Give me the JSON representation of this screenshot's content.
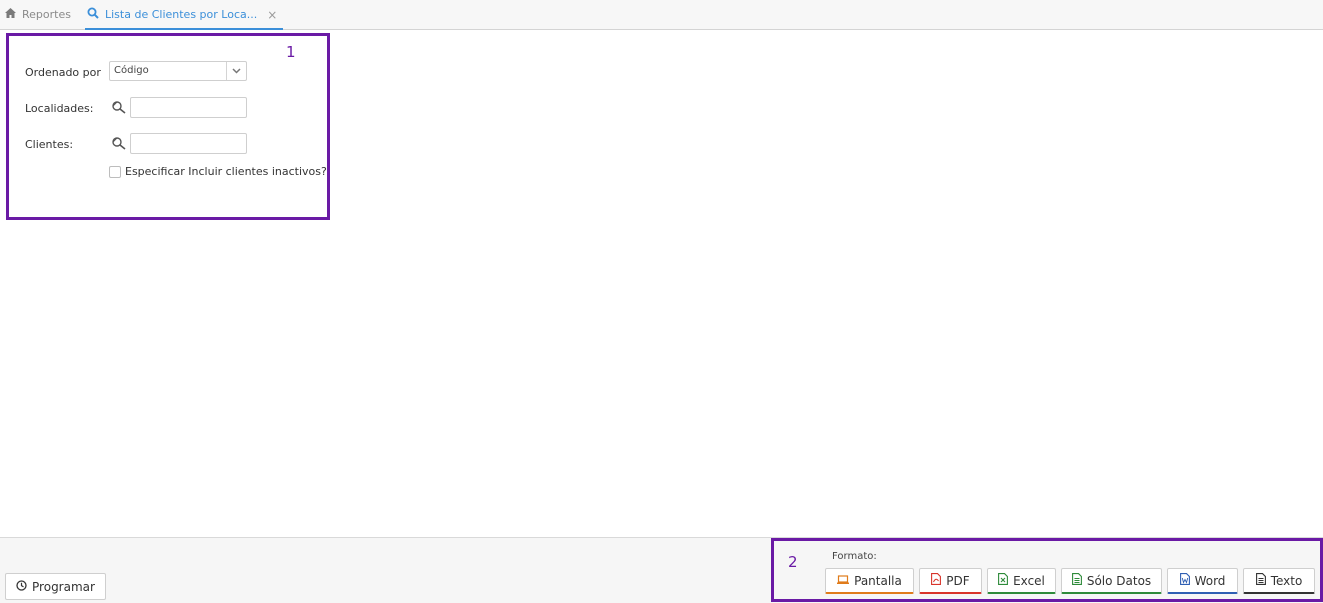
{
  "tabs": [
    {
      "label": "Reportes",
      "icon": "home-icon"
    },
    {
      "label": "Lista de Clientes por Loca...",
      "icon": "search-icon",
      "active": true
    }
  ],
  "annotations": {
    "box1": "1",
    "box2": "2"
  },
  "form": {
    "order_label": "Ordenado por",
    "order_value": "Código",
    "localidades_label": "Localidades:",
    "localidades_value": "",
    "clientes_label": "Clientes:",
    "clientes_value": "",
    "checkbox_label": "Especificar Incluir clientes inactivos?"
  },
  "footer": {
    "programar_label": "Programar",
    "formato_label": "Formato:",
    "formats": [
      {
        "label": "Pantalla",
        "accent": "#e07b1a",
        "icon": "monitor-icon"
      },
      {
        "label": "PDF",
        "accent": "#d9342b",
        "icon": "pdf-icon"
      },
      {
        "label": "Excel",
        "accent": "#2e8b3a",
        "icon": "excel-icon"
      },
      {
        "label": "Sólo Datos",
        "accent": "#2e8b3a",
        "icon": "data-file-icon"
      },
      {
        "label": "Word",
        "accent": "#2f5fb3",
        "icon": "word-icon"
      },
      {
        "label": "Texto",
        "accent": "#333333",
        "icon": "text-file-icon"
      }
    ]
  },
  "colors": {
    "accent": "#3b8fd9",
    "annotation": "#6a1aa5"
  }
}
